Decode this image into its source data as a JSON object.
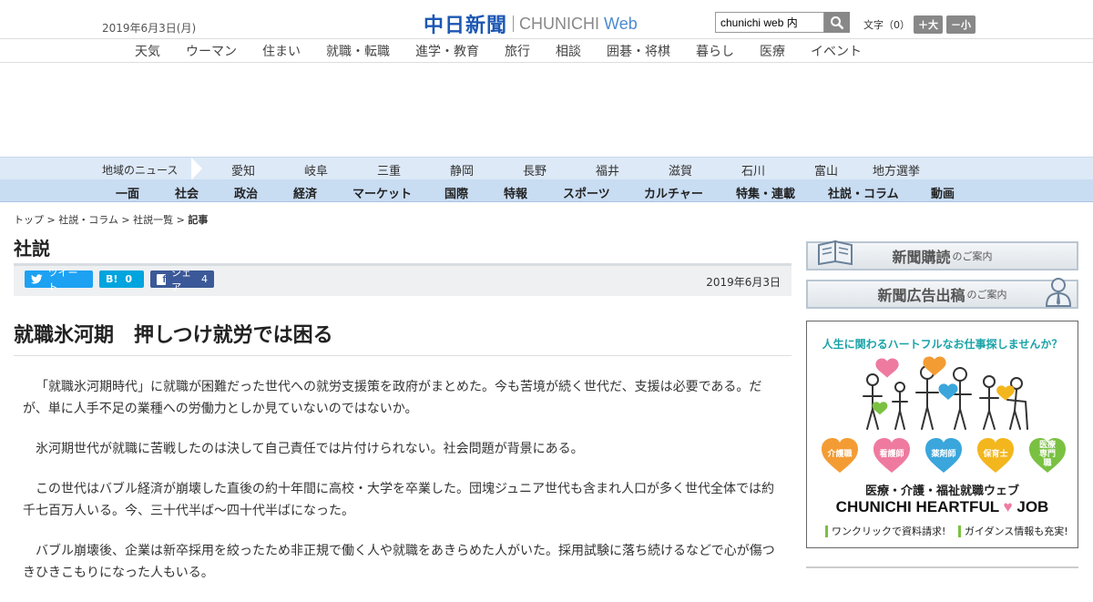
{
  "header": {
    "date": "2019年6月3日(月)",
    "logo_ja": "中日新聞",
    "logo_en_prefix": "CHUNICHI",
    "logo_en_suffix": "Web",
    "search_value": "chunichi web 内",
    "font_size_label": "文字（0）",
    "font_plus": "＋大",
    "font_minus": "－小"
  },
  "topnav": [
    "天気",
    "ウーマン",
    "住まい",
    "就職・転職",
    "進学・教育",
    "旅行",
    "相談",
    "囲碁・将棋",
    "暮らし",
    "医療",
    "イベント"
  ],
  "region": {
    "label": "地域のニュース",
    "items": [
      "愛知",
      "岐阜",
      "三重",
      "静岡",
      "長野",
      "福井",
      "滋賀",
      "石川",
      "富山",
      "地方選挙"
    ]
  },
  "mainnav": [
    "一面",
    "社会",
    "政治",
    "経済",
    "マーケット",
    "国際",
    "特報",
    "スポーツ",
    "カルチャー",
    "特集・連載",
    "社説・コラム",
    "動画"
  ],
  "breadcrumb": {
    "top": "トップ",
    "sep": ">",
    "section": "社説・コラム",
    "list": "社説一覧",
    "current": "記事"
  },
  "section_title": "社説",
  "share": {
    "tweet": "ツイート",
    "hatena_label": "B!",
    "hatena_count": "0",
    "facebook": "シェア",
    "facebook_count": "4"
  },
  "article": {
    "date": "2019年6月3日",
    "headline": "就職氷河期　押しつけ就労では困る",
    "paragraphs": [
      "「就職氷河期時代」に就職が困難だった世代への就労支援策を政府がまとめた。今も苦境が続く世代だ、支援は必要である。だが、単に人手不足の業種への労働力としか見ていないのではないか。",
      "氷河期世代が就職に苦戦したのは決して自己責任では片付けられない。社会問題が背景にある。",
      "この世代はバブル経済が崩壊した直後の約十年間に高校・大学を卒業した。団塊ジュニア世代も含まれ人口が多く世代全体では約千七百万人いる。今、三十代半ば～四十代半ばになった。",
      "バブル崩壊後、企業は新卒採用を絞ったため非正規で働く人や就職をあきらめた人がいた。採用試験に落ち続けるなどで心が傷つきひきこもりになった人もいる。"
    ]
  },
  "sidebar": {
    "banner1": "新聞購読",
    "banner1_small": "のご案内",
    "banner2": "新聞広告出稿",
    "banner2_small": "のご案内",
    "ad": {
      "tagline": "人生に関わるハートフルなお仕事探しませんか？",
      "hearts": [
        "介護職",
        "看護師",
        "薬剤師",
        "保育士",
        "医療専門職"
      ],
      "heart_colors": [
        "#f39c34",
        "#ef7aa0",
        "#3aa6dc",
        "#f3b61d",
        "#7ac142"
      ],
      "subtitle": "医療・介護・福祉就職ウェブ",
      "brand_pre": "CHUNICHI HEARTFUL",
      "brand_post": "JOB",
      "bottom_1": "ワンクリックで資料請求!",
      "bottom_2": "ガイダンス情報も充実!"
    }
  }
}
